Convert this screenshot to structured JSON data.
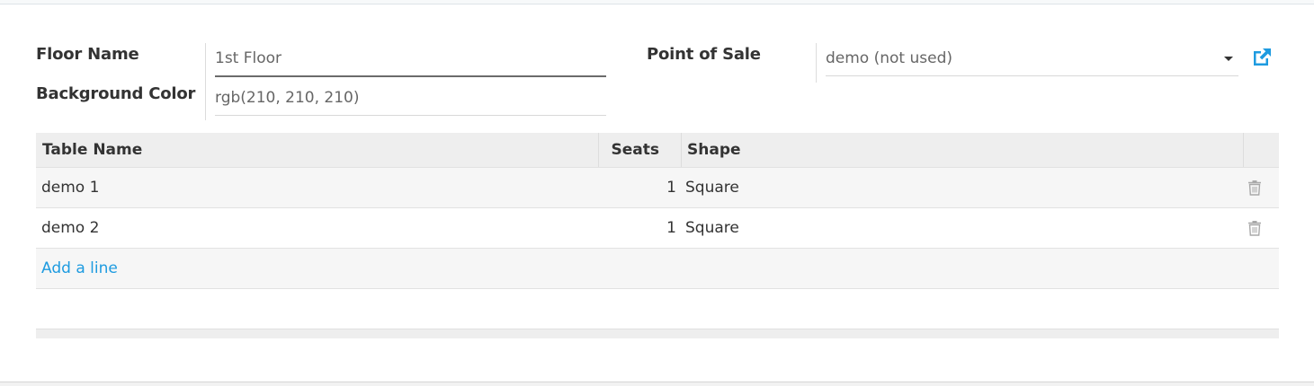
{
  "form": {
    "floor_name_label": "Floor Name",
    "floor_name_value": "1st Floor",
    "background_color_label": "Background Color",
    "background_color_value": "rgb(210, 210, 210)",
    "point_of_sale_label": "Point of Sale",
    "point_of_sale_value": "demo (not used)"
  },
  "table": {
    "columns": [
      "Table Name",
      "Seats",
      "Shape"
    ],
    "rows": [
      {
        "name": "demo 1",
        "seats": "1",
        "shape": "Square"
      },
      {
        "name": "demo 2",
        "seats": "1",
        "shape": "Square"
      }
    ],
    "add_line_label": "Add a line"
  },
  "icons": {
    "dropdown": "caret-down-icon",
    "external_link": "external-link-icon",
    "delete": "trash-icon"
  },
  "colors": {
    "link": "#1e9be0",
    "header_bg": "#eeeeee",
    "odd_row_bg": "#f6f6f6"
  }
}
